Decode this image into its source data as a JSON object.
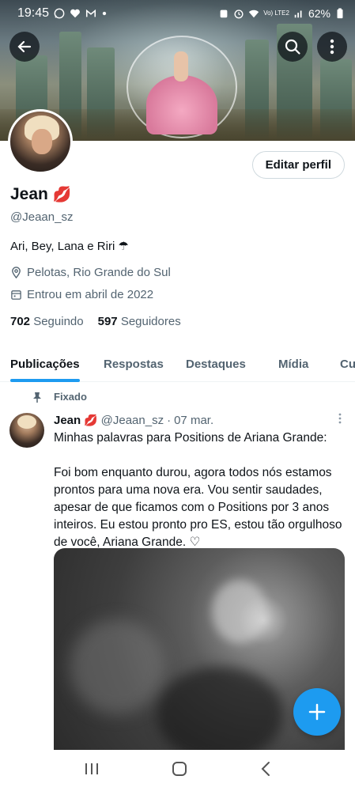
{
  "status_bar": {
    "time": "19:45",
    "network": "Vo) LTE2",
    "battery": "62%",
    "icons": [
      "whatsapp-icon",
      "heart-icon",
      "gmail-icon",
      "dot-icon",
      "alarm-icon",
      "wifi-icon",
      "signal-icon",
      "battery-icon"
    ]
  },
  "header": {
    "back_icon": "arrow-left-icon",
    "search_icon": "search-icon",
    "more_icon": "more-vertical-icon"
  },
  "profile": {
    "name": "Jean",
    "name_emoji": "💋",
    "handle": "@Jeaan_sz",
    "bio": "Ari, Bey, Lana e Riri ☂",
    "location": "Pelotas, Rio Grande do Sul",
    "joined": "Entrou em abril de 2022",
    "following_count": "702",
    "following_label": "Seguindo",
    "followers_count": "597",
    "followers_label": "Seguidores",
    "edit_button": "Editar perfil"
  },
  "tabs": [
    {
      "label": "Publicações",
      "active": true
    },
    {
      "label": "Respostas",
      "active": false
    },
    {
      "label": "Destaques",
      "active": false
    },
    {
      "label": "Mídia",
      "active": false
    },
    {
      "label": "Cu",
      "active": false
    }
  ],
  "post": {
    "pinned_label": "Fixado",
    "author": "Jean",
    "author_emoji": "💋",
    "handle": "@Jeaan_sz",
    "separator": "·",
    "date": "07 mar.",
    "text": "Minhas palavras para Positions de Ariana Grande:\n\nFoi bom enquanto durou, agora todos nós estamos prontos para uma nova era. Vou sentir saudades, apesar de que ficamos com o Positions por 3 anos inteiros. Eu estou pronto pro ES, estou tão orgulhoso de você, Ariana Grande. ♡"
  },
  "fab": {
    "icon": "plus-icon"
  },
  "nav": {
    "icons": [
      "recent-apps-icon",
      "home-icon",
      "back-icon"
    ]
  },
  "colors": {
    "accent": "#1d9bf0",
    "text": "#0f1419",
    "secondary": "#536471"
  }
}
